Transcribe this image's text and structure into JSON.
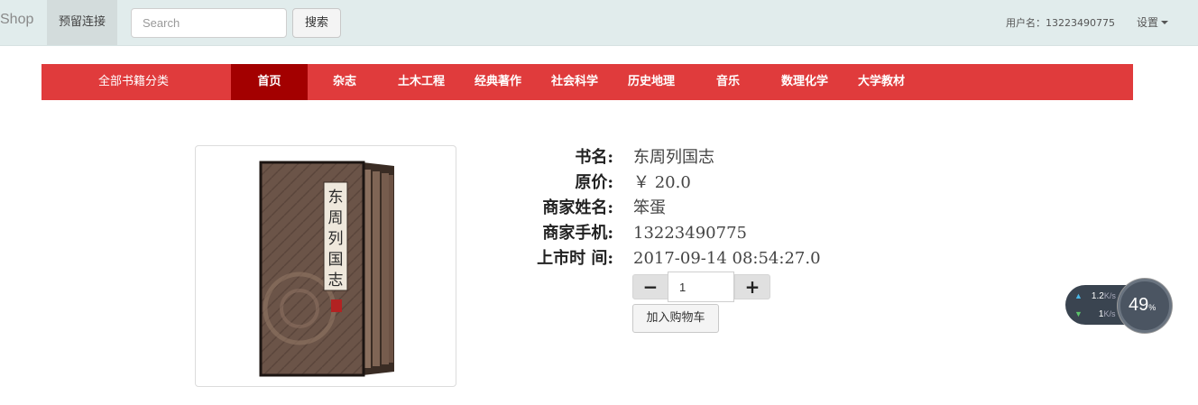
{
  "navbar": {
    "brand": "Shop",
    "tab_label": "预留连接",
    "search_placeholder": "Search",
    "search_button": "搜索",
    "user_label": "用户名：13223490775",
    "settings_label": "设置"
  },
  "categories": {
    "all_label": "全部书籍分类",
    "items": [
      {
        "label": "首页",
        "active": true
      },
      {
        "label": "杂志",
        "active": false
      },
      {
        "label": "土木工程",
        "active": false
      },
      {
        "label": "经典著作",
        "active": false
      },
      {
        "label": "社会科学",
        "active": false
      },
      {
        "label": "历史地理",
        "active": false
      },
      {
        "label": "音乐",
        "active": false
      },
      {
        "label": "数理化学",
        "active": false
      },
      {
        "label": "大学教材",
        "active": false
      }
    ]
  },
  "product": {
    "cover_title": "东周列国志",
    "fields": [
      {
        "label": "书名:",
        "value": "东周列国志"
      },
      {
        "label": "原价:",
        "value": "￥ 20.0"
      },
      {
        "label": "商家姓名:",
        "value": "笨蛋"
      },
      {
        "label": "商家手机:",
        "value": "13223490775"
      },
      {
        "label": "上市时 间:",
        "value": "2017-09-14 08:54:27.0"
      }
    ],
    "quantity": "1",
    "minus_label": "−",
    "plus_label": "+",
    "add_to_cart": "加入购物车"
  },
  "speed_widget": {
    "upload": "1.2",
    "upload_unit": "K/s",
    "download": "1",
    "download_unit": "K/s",
    "percent": "49",
    "percent_unit": "%"
  },
  "colors": {
    "category_bar": "#e03b3c",
    "category_active": "#a30000",
    "topbar": "#e1ecec"
  }
}
